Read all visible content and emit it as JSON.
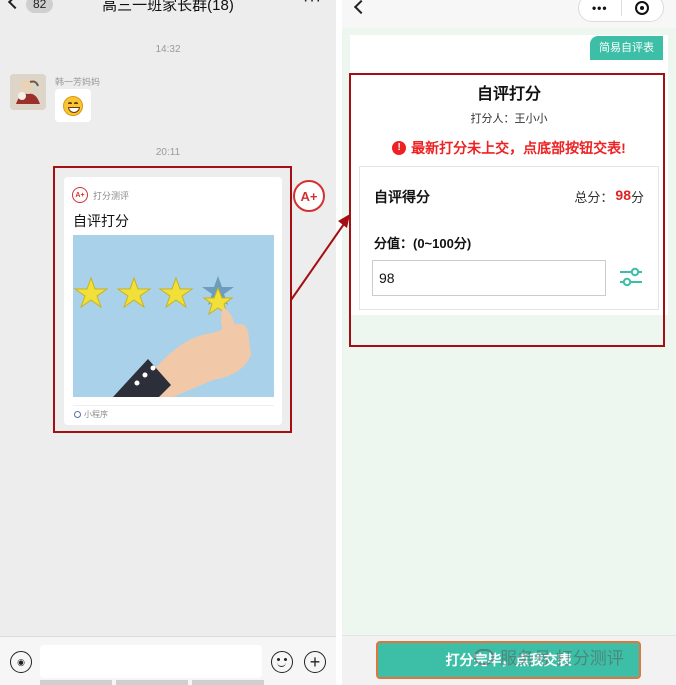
{
  "chat": {
    "back_badge": "82",
    "title": "高三一班家长群(18)",
    "more": "···",
    "times": [
      "14:32",
      "20:11"
    ],
    "sender_name": "韩一芳妈妈",
    "card": {
      "app_name": "打分测评",
      "title": "自评打分",
      "footer": "小程序"
    },
    "app_avatar_text": "A+",
    "input_placeholder": ""
  },
  "app": {
    "tag": "简易自评表",
    "title": "自评打分",
    "scorer": "打分人：王小小",
    "warning": "最新打分未上交，点底部按钮交表!",
    "score_label": "自评得分",
    "total_label": "总分：",
    "total_value": "98",
    "total_unit": "分",
    "range_label": "分值：(0~100分)",
    "score_value": "98",
    "submit_label": "打分完毕，点我交表"
  },
  "watermark": "服务号  打分测评",
  "colors": {
    "accent": "#3dbfa7",
    "warning": "#ee2222",
    "highlight_border": "#a30f13",
    "chat_bg": "#ededed"
  },
  "icons": [
    "chevron-left-icon",
    "more-icon",
    "emoji-icon",
    "voice-icon",
    "plus-icon",
    "slider-settings-icon",
    "warning-icon",
    "close-circle-icon",
    "link-icon"
  ]
}
